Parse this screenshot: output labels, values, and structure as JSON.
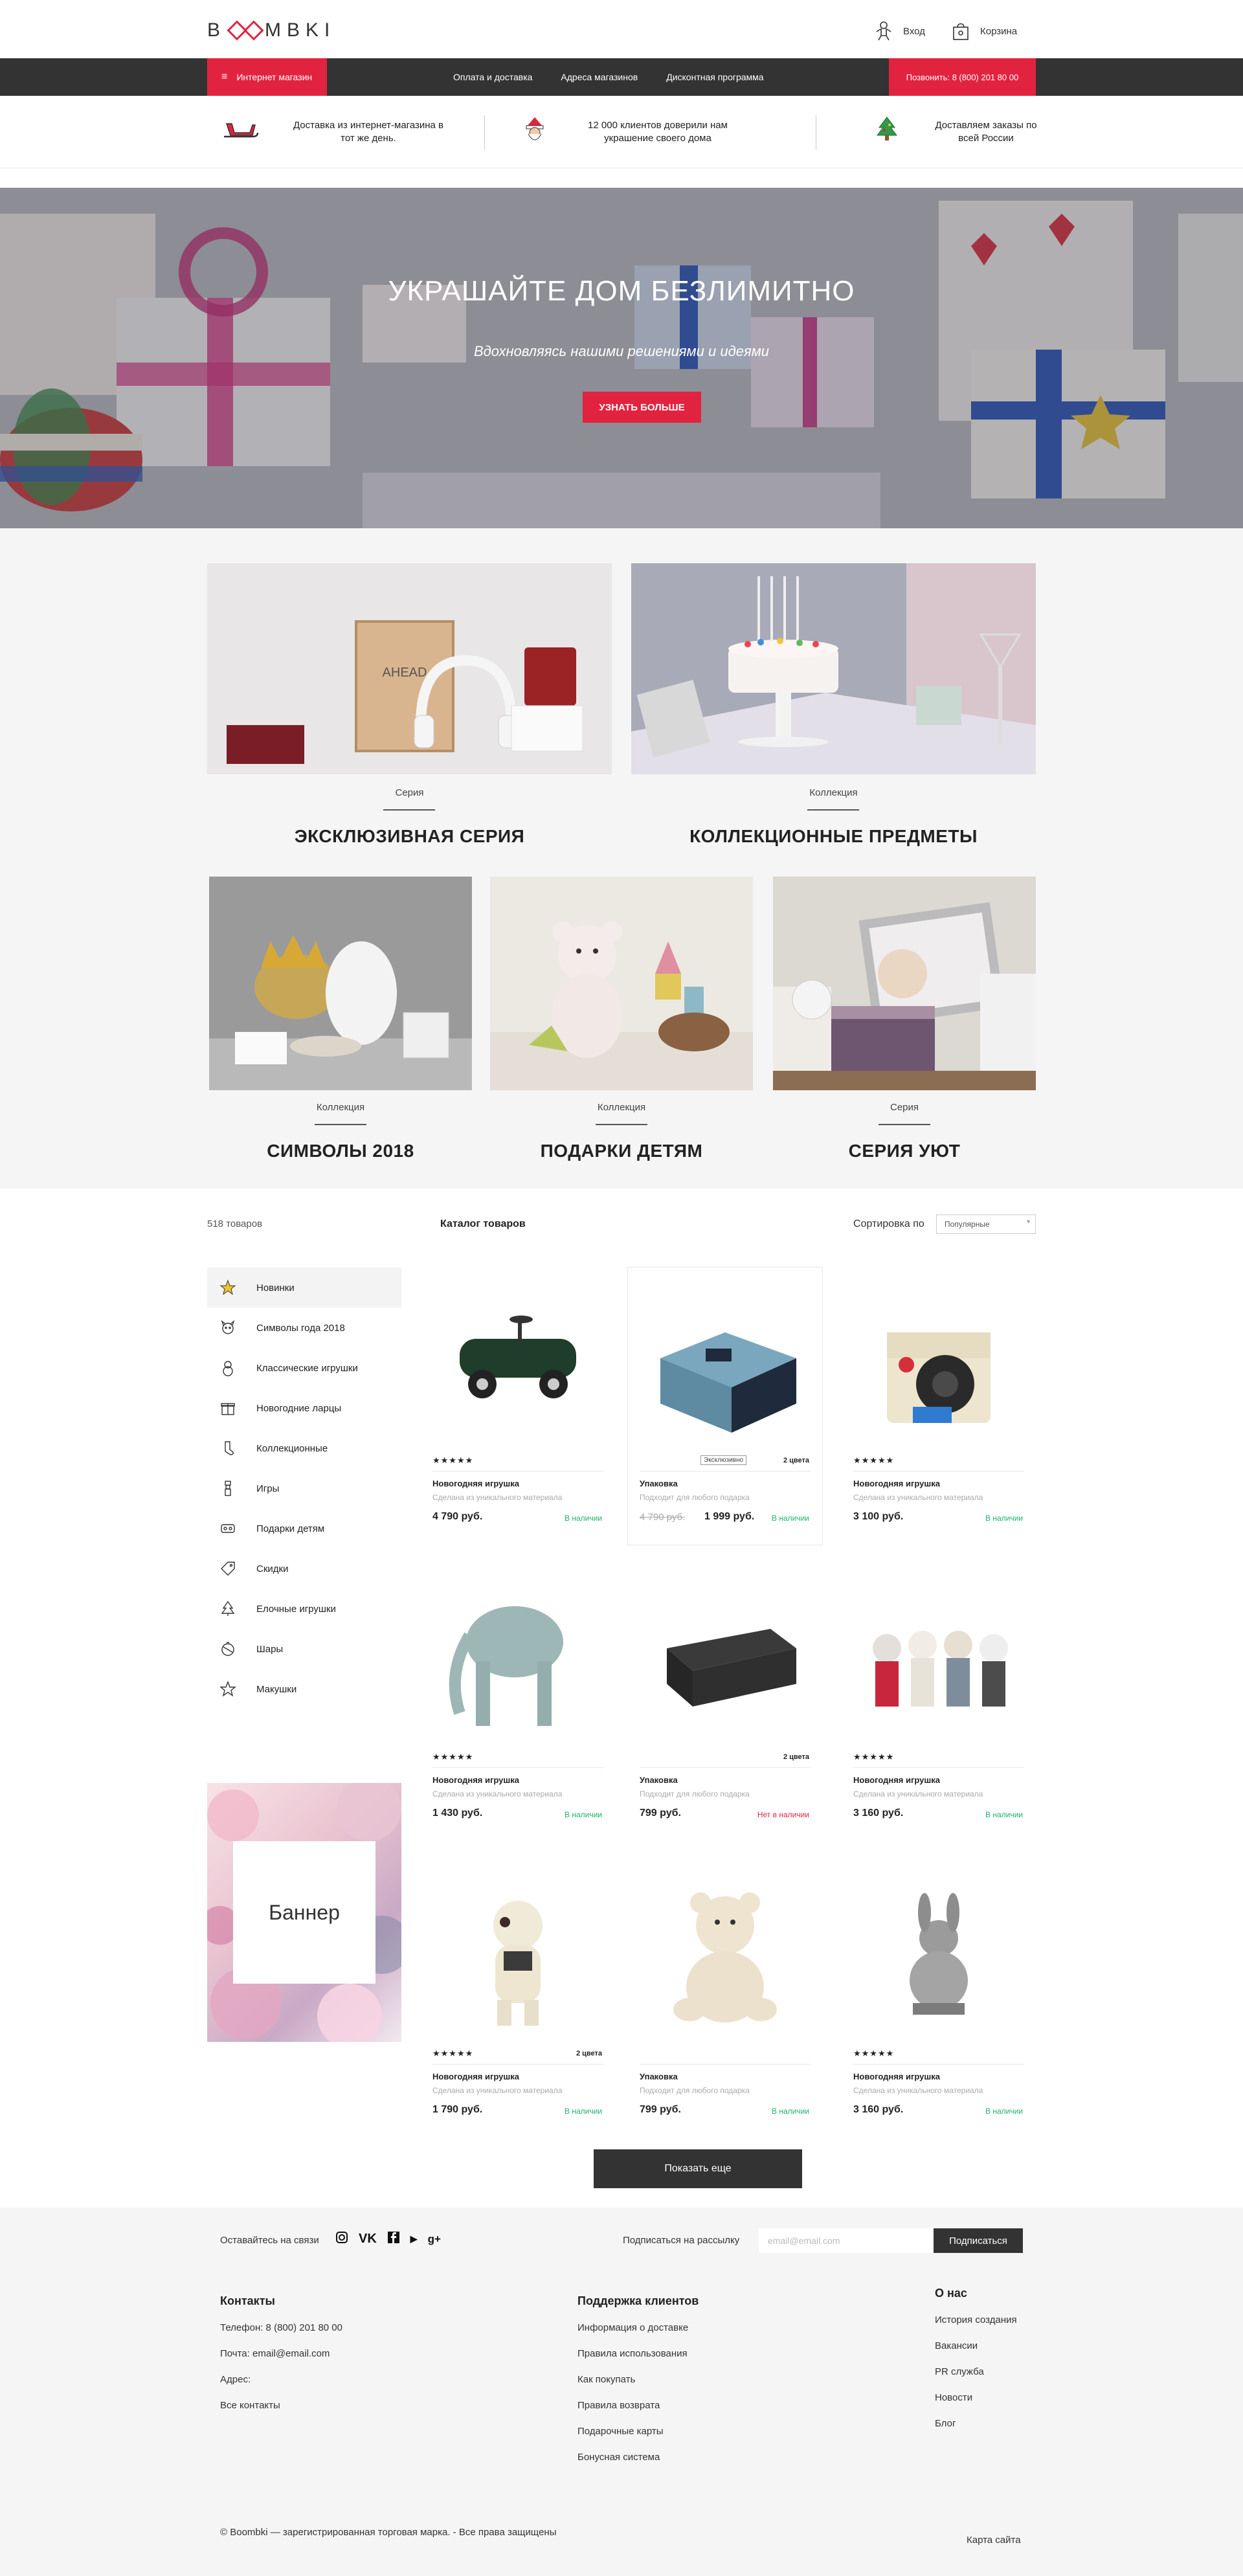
{
  "header": {
    "logo": "BOOMBKI",
    "login_label": "Вход",
    "cart_label": "Корзина"
  },
  "nav": {
    "shop_label": "Интернет магазин",
    "links": [
      "Оплата и доставка",
      "Адреса магазинов",
      "Дисконтная программа"
    ],
    "phone_label": "Позвонить: 8 (800) 201 80 00"
  },
  "features": [
    {
      "icon": "sleigh-icon",
      "text": "Доставка из интернет-магазина в тот же день."
    },
    {
      "icon": "santa-icon",
      "text": "12 000 клиентов доверили нам украшение своего дома"
    },
    {
      "icon": "christmas-tree-icon",
      "text": "Доставляем заказы по всей России"
    }
  ],
  "hero": {
    "title": "УКРАШАЙТЕ ДОМ БЕЗЛИМИТНО",
    "subtitle": "Вдохновляясь нашими решениями и идеями",
    "button": "УЗНАТЬ БОЛЬШЕ"
  },
  "collections": [
    {
      "type": "Серия",
      "title": "ЭКСКЛЮЗИВНАЯ СЕРИЯ"
    },
    {
      "type": "Коллекция",
      "title": "КОЛЛЕКЦИОННЫЕ ПРЕДМЕТЫ"
    },
    {
      "type": "Коллекция",
      "title": "СИМВОЛЫ 2018"
    },
    {
      "type": "Коллекция",
      "title": "ПОДАРКИ ДЕТЯМ"
    },
    {
      "type": "Серия",
      "title": "СЕРИЯ УЮТ"
    }
  ],
  "catalog": {
    "count": "518 товаров",
    "title": "Каталог товаров",
    "sort_label": "Сортировка по",
    "sort_value": "Популярные",
    "categories": [
      {
        "label": "Новинки",
        "icon": "star-icon"
      },
      {
        "label": "Символы года 2018",
        "icon": "dog-icon"
      },
      {
        "label": "Классические игрушки",
        "icon": "snowman-icon"
      },
      {
        "label": "Новогодние ларцы",
        "icon": "gift-box-icon"
      },
      {
        "label": "Коллекционные",
        "icon": "stocking-icon"
      },
      {
        "label": "Игры",
        "icon": "nutcracker-icon"
      },
      {
        "label": "Подарки детям",
        "icon": "toy-icon"
      },
      {
        "label": "Скидки",
        "icon": "tag-icon"
      },
      {
        "label": "Елочные игрушки",
        "icon": "tree-icon"
      },
      {
        "label": "Шары",
        "icon": "ball-icon"
      },
      {
        "label": "Макушки",
        "icon": "tree-top-star-icon"
      }
    ],
    "banner": "Баннер",
    "products": [
      {
        "name": "Новогодняя игрушка",
        "desc": "Сделана из уникального материала",
        "price": "4 790 руб.",
        "stock": "В наличии",
        "in_stock": true,
        "stars": "★★★★★",
        "colors": "",
        "tag": "",
        "old_price": ""
      },
      {
        "name": "Упаковка",
        "desc": "Подходит для любого подарка",
        "price": "1 999 руб.",
        "stock": "В наличии",
        "in_stock": true,
        "stars": "",
        "colors": "2 цвета",
        "tag": "Эксклюзивно",
        "old_price": "4 790 руб."
      },
      {
        "name": "Новогодняя игрушка",
        "desc": "Сделана из уникального материала",
        "price": "3 100 руб.",
        "stock": "В наличии",
        "in_stock": true,
        "stars": "★★★★★",
        "colors": "",
        "tag": "",
        "old_price": ""
      },
      {
        "name": "Новогодняя игрушка",
        "desc": "Сделана из уникального материала",
        "price": "1 430 руб.",
        "stock": "В наличии",
        "in_stock": true,
        "stars": "★★★★★",
        "colors": "",
        "tag": "",
        "old_price": ""
      },
      {
        "name": "Упаковка",
        "desc": "Подходит для любого подарка",
        "price": "799 руб.",
        "stock": "Нет в наличии",
        "in_stock": false,
        "stars": "",
        "colors": "2 цвета",
        "tag": "",
        "old_price": ""
      },
      {
        "name": "Новогодняя игрушка",
        "desc": "Сделана из уникального материала",
        "price": "3 160 руб.",
        "stock": "В наличии",
        "in_stock": true,
        "stars": "★★★★★",
        "colors": "",
        "tag": "",
        "old_price": ""
      },
      {
        "name": "Новогодняя игрушка",
        "desc": "Сделана из уникального материала",
        "price": "1 790 руб.",
        "stock": "В наличии",
        "in_stock": true,
        "stars": "★★★★★",
        "colors": "2 цвета",
        "tag": "",
        "old_price": ""
      },
      {
        "name": "Упаковка",
        "desc": "Подходит для любого подарка",
        "price": "799 руб.",
        "stock": "В наличии",
        "in_stock": true,
        "stars": "",
        "colors": "",
        "tag": "",
        "old_price": ""
      },
      {
        "name": "Новогодняя игрушка",
        "desc": "Сделана из уникального материала",
        "price": "3 160 руб.",
        "stock": "В наличии",
        "in_stock": true,
        "stars": "★★★★★",
        "colors": "",
        "tag": "",
        "old_price": ""
      }
    ],
    "more_button": "Показать еще"
  },
  "footer": {
    "social_label": "Оставайтесь на связи",
    "newsletter_label": "Подписаться на рассылку",
    "email_placeholder": "email@email.com",
    "subscribe_button": "Подписаться",
    "contacts": {
      "title": "Контакты",
      "items": [
        "Телефон: 8 (800) 201 80 00",
        "Почта: email@email.com",
        "Адрес:",
        "Все контакты"
      ]
    },
    "support": {
      "title": "Поддержка клиентов",
      "items": [
        "Информация о доставке",
        "Правила использования",
        "Как покупать",
        "Правила возврата",
        "Подарочные карты",
        "Бонусная система"
      ]
    },
    "about": {
      "title": "О нас",
      "items": [
        "История создания",
        "Вакансии",
        "PR служба",
        "Новости",
        "Блог"
      ]
    },
    "copyright": "© Boombki — зарегистрированная торговая марка. - Все права защищены",
    "sitemap": "Карта сайта"
  },
  "colors": {
    "accent": "#e2233f",
    "dark": "#333333",
    "in_stock": "#1fb36b"
  }
}
